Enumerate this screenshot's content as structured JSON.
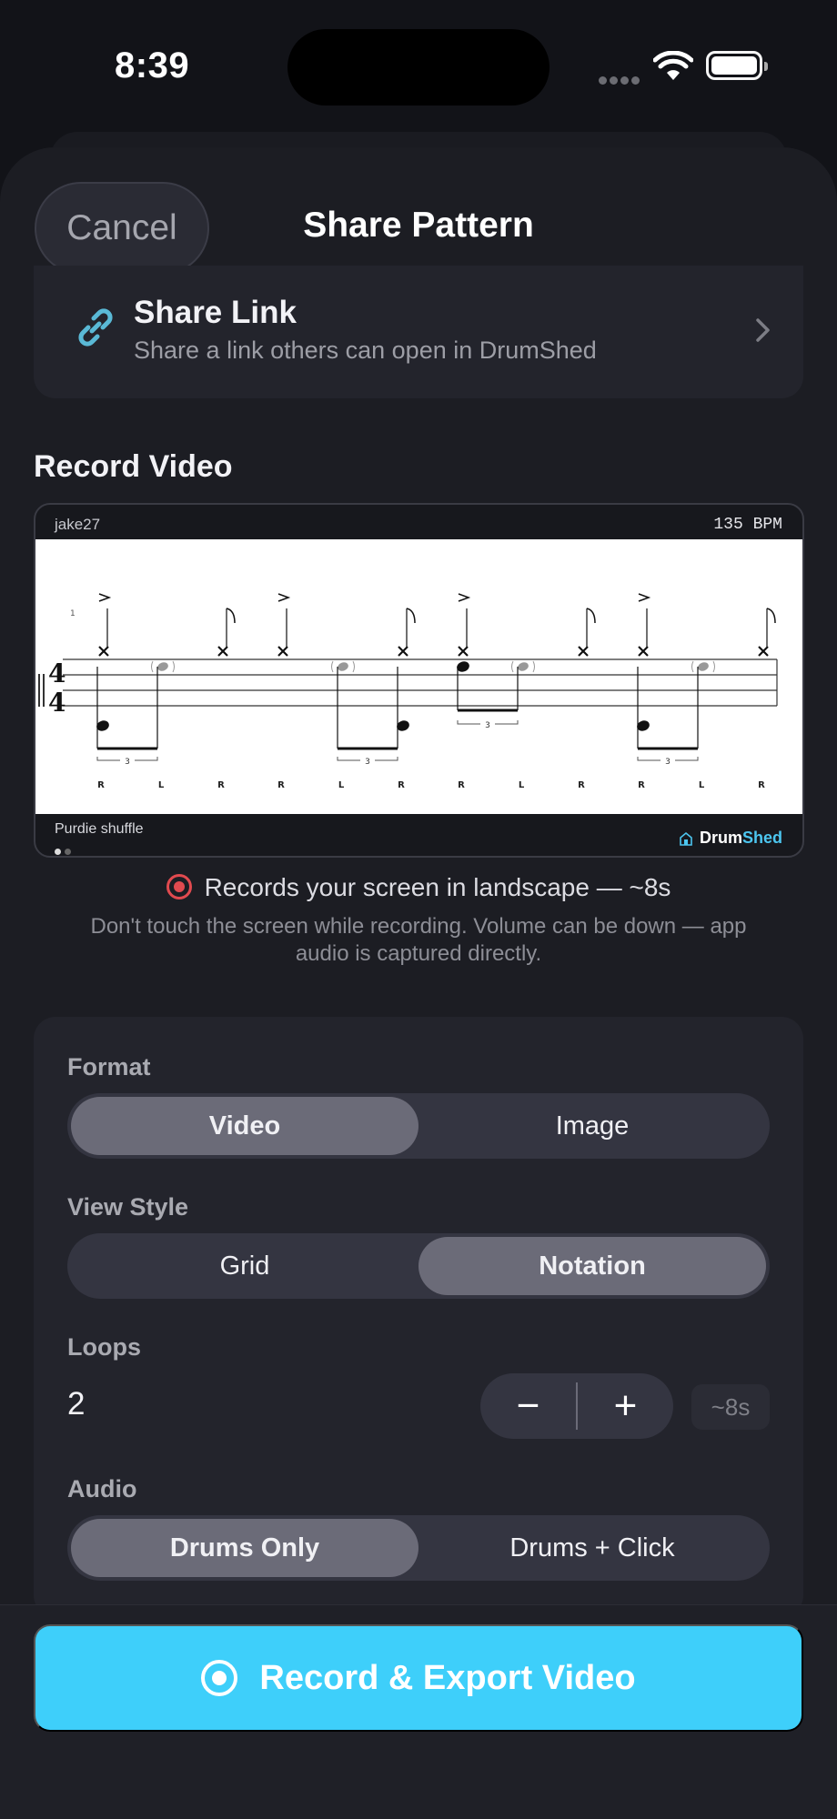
{
  "status_bar": {
    "time": "8:39"
  },
  "header": {
    "cancel_label": "Cancel",
    "title": "Share Pattern"
  },
  "share_link": {
    "title": "Share Link",
    "subtitle": "Share a link others can open in DrumShed"
  },
  "record_video": {
    "section_title": "Record Video",
    "preview": {
      "username": "jake27",
      "bpm": "135 BPM",
      "pattern_name": "Purdie shuffle",
      "brand_prefix": "Drum",
      "brand_suffix": "Shed",
      "time_signature": [
        "4",
        "4"
      ],
      "measure_number": "1",
      "tuplet": "3",
      "sticking": [
        "R",
        "L",
        "R",
        "R",
        "L",
        "R",
        "R",
        "L",
        "R",
        "R",
        "L",
        "R"
      ],
      "page_count": 2,
      "active_page": 1
    },
    "note": "Records your screen in landscape — ~8s",
    "hint": "Don't touch the screen while recording. Volume can be down — app audio is captured directly."
  },
  "settings": {
    "format": {
      "label": "Format",
      "options": [
        "Video",
        "Image"
      ],
      "selected": "Video"
    },
    "view_style": {
      "label": "View Style",
      "options": [
        "Grid",
        "Notation"
      ],
      "selected": "Notation"
    },
    "loops": {
      "label": "Loops",
      "value": "2",
      "minus": "−",
      "plus": "+",
      "duration": "~8s"
    },
    "audio": {
      "label": "Audio",
      "options": [
        "Drums Only",
        "Drums + Click"
      ],
      "selected": "Drums Only"
    }
  },
  "cta": {
    "label": "Record & Export Video"
  },
  "colors": {
    "accent": "#3ecffa",
    "record_red": "#e14a4f",
    "sheet_bg": "#1c1d23",
    "card_bg": "#23242c"
  }
}
